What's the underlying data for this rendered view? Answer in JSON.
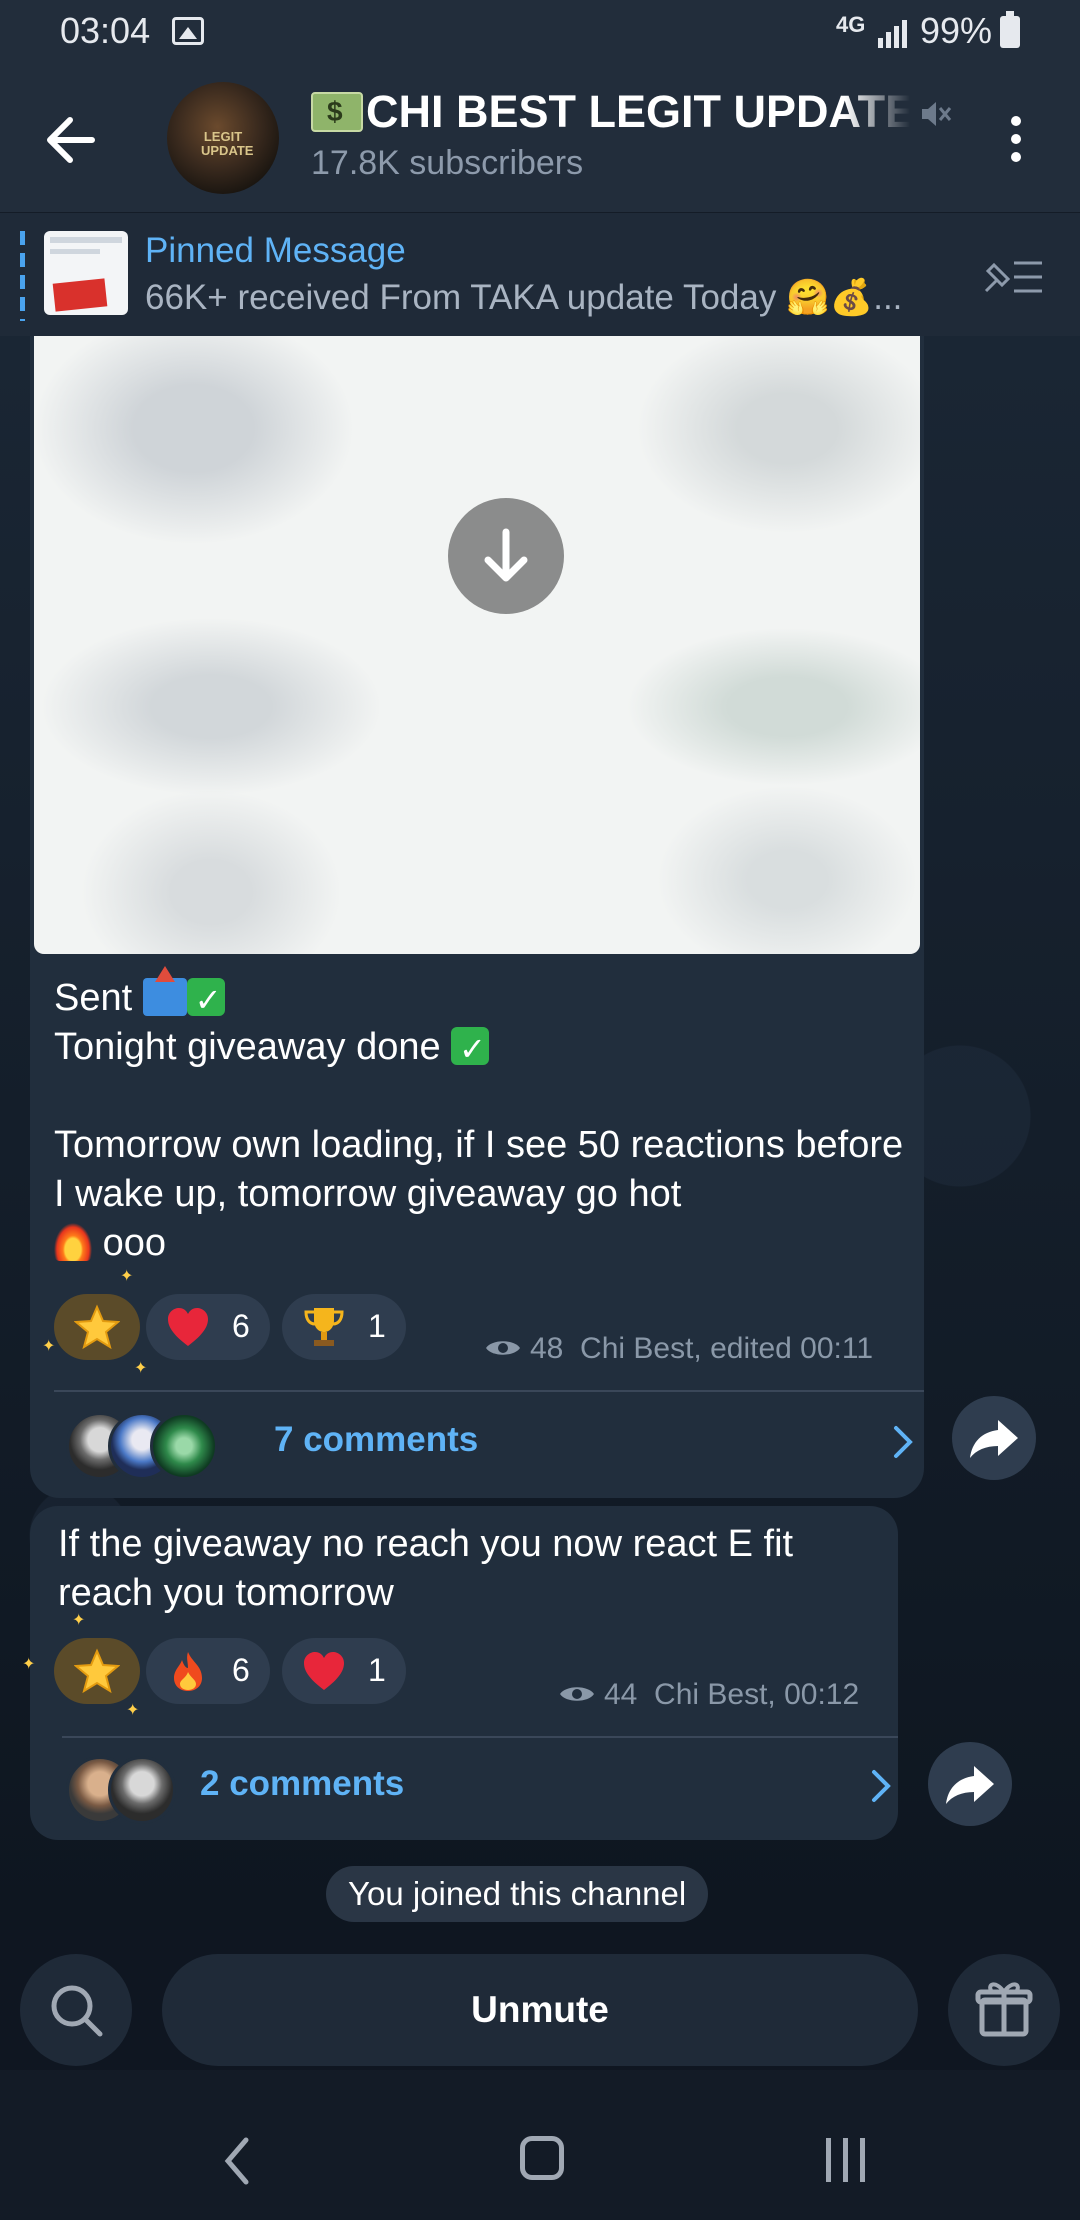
{
  "status_bar": {
    "time": "03:04",
    "network": "4G",
    "battery": "99%"
  },
  "header": {
    "title": "CHI BEST LEGIT UPDATES",
    "subscribers": "17.8K subscribers",
    "avatar_text": "LEGIT UPDATE"
  },
  "pinned": {
    "label": "Pinned Message",
    "text": "66K+ received From TAKA update Today 🤗💰..."
  },
  "messages": [
    {
      "line1": "Sent",
      "line2": "Tonight giveaway done",
      "line3": "Tomorrow own loading, if I see 50 reactions before I wake up, tomorrow giveaway go hot",
      "line4": "ooo",
      "reactions": [
        {
          "emoji": "star",
          "count": ""
        },
        {
          "emoji": "heart",
          "count": "6"
        },
        {
          "emoji": "trophy",
          "count": "1"
        }
      ],
      "views": "48",
      "author_time": "Chi Best, edited 00:11",
      "comments": "7 comments"
    },
    {
      "text": "If the giveaway no reach you now react E fit reach you tomorrow",
      "reactions": [
        {
          "emoji": "star",
          "count": ""
        },
        {
          "emoji": "fire",
          "count": "6"
        },
        {
          "emoji": "heart",
          "count": "1"
        }
      ],
      "views": "44",
      "author_time": "Chi Best, 00:12",
      "comments": "2 comments"
    }
  ],
  "service_message": "You joined this channel",
  "bottom_bar": {
    "unmute_label": "Unmute"
  },
  "colors": {
    "accent": "#5fb3f6",
    "bubble": "#212e3d",
    "header": "#222d3b"
  }
}
